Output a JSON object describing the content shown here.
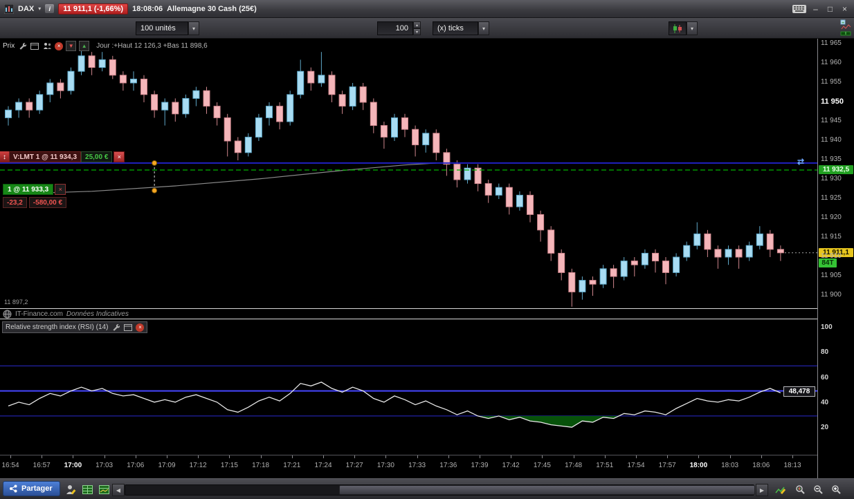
{
  "titlebar": {
    "symbol": "DAX",
    "price_badge": "11 911,1 (-1,66%)",
    "time": "18:08:06",
    "instrument": "Allemagne 30 Cash (25€)"
  },
  "toolbar": {
    "units": "100 unités",
    "interval_value": "100",
    "interval_type": "(x) ticks"
  },
  "price_pane": {
    "label": "Prix",
    "day_info": "Jour :+Haut 12 126,3 +Bas 11 898,6",
    "order_tag": {
      "text": "V:LMT 1 @ 11 934,3",
      "amount": "25,00 €"
    },
    "position_tag": {
      "text": "1 @ 11 933,3",
      "pnl_points": "-23,2",
      "pnl_amount": "-580,00 €"
    },
    "low_label": "11 897,2",
    "watermark": "IT-Finance.com",
    "watermark_note": "Données Indicatives",
    "badges": {
      "last": "11 911,1",
      "ticks": "84T",
      "position": "11 932,5"
    }
  },
  "rsi_pane": {
    "label": "Relative strength index (RSI) (14)",
    "value_label": "48,478",
    "value": 48.478
  },
  "bottombar": {
    "share": "Partager"
  },
  "icons": {
    "dropdown": "▾",
    "spin_up": "▴",
    "spin_down": "▾",
    "minimize": "–",
    "maximize": "□",
    "close": "×",
    "left": "◀",
    "right": "▶",
    "updown": "↕",
    "order_marker": "⇄",
    "sell_arrow": "▼",
    "buy_arrow": "▲",
    "info": "i",
    "x": "×"
  },
  "colors": {
    "up_fill": "#a8dcf3",
    "up_stroke": "#5fa8c9",
    "down_fill": "#f5b6ba",
    "down_stroke": "#cf868d",
    "rsi_line": "#e8e8e8",
    "level_blue": "#2b2bd0",
    "level_blue_bright": "#4646ff",
    "fill_green": "#07520a",
    "order_blue": "#2222cc",
    "position_green": "#00b300",
    "badge_yellow": "#e7c51e",
    "badge_green": "#22a022",
    "price_red_badge": "#c62828"
  },
  "x_labels": [
    {
      "t": "16:54"
    },
    {
      "t": "16:57"
    },
    {
      "t": "17:00",
      "em": true
    },
    {
      "t": "17:03"
    },
    {
      "t": "17:06"
    },
    {
      "t": "17:09"
    },
    {
      "t": "17:12"
    },
    {
      "t": "17:15"
    },
    {
      "t": "17:18"
    },
    {
      "t": "17:21"
    },
    {
      "t": "17:24"
    },
    {
      "t": "17:27"
    },
    {
      "t": "17:30"
    },
    {
      "t": "17:33"
    },
    {
      "t": "17:36"
    },
    {
      "t": "17:39"
    },
    {
      "t": "17:42"
    },
    {
      "t": "17:45"
    },
    {
      "t": "17:48"
    },
    {
      "t": "17:51"
    },
    {
      "t": "17:54"
    },
    {
      "t": "17:57"
    },
    {
      "t": "18:00",
      "em": true
    },
    {
      "t": "18:03"
    },
    {
      "t": "18:06"
    },
    {
      "t": "18:13"
    }
  ],
  "chart_data": [
    {
      "type": "candlestick",
      "title": "Prix",
      "ylim": [
        11897,
        11967
      ],
      "y_ticks": [
        {
          "v": 11965,
          "t": "11 965"
        },
        {
          "v": 11960,
          "t": "11 960"
        },
        {
          "v": 11955,
          "t": "11 955"
        },
        {
          "v": 11950,
          "t": "11 950",
          "em": true
        },
        {
          "v": 11945,
          "t": "11 945"
        },
        {
          "v": 11940,
          "t": "11 940"
        },
        {
          "v": 11935,
          "t": "11 935"
        },
        {
          "v": 11930,
          "t": "11 930"
        },
        {
          "v": 11925,
          "t": "11 925"
        },
        {
          "v": 11920,
          "t": "11 920"
        },
        {
          "v": 11915,
          "t": "11 915"
        },
        {
          "v": 11910,
          "t": "11 910"
        },
        {
          "v": 11905,
          "t": "11 905"
        },
        {
          "v": 11900,
          "t": "11 900"
        }
      ],
      "order_line": {
        "price": 11934.3
      },
      "position_line": {
        "price": 11932.5
      },
      "last_price": {
        "value": 11911.1
      },
      "day_high": 12126.3,
      "day_low": 11898.6,
      "session_low_label": 11897.2,
      "avg_line": {
        "points": [
          [
            0,
            11926.3
          ],
          [
            8,
            11927.0
          ],
          [
            16,
            11928.4
          ],
          [
            24,
            11930.2
          ],
          [
            32,
            11932.4
          ],
          [
            38,
            11933.8
          ],
          [
            41,
            11934.3
          ]
        ],
        "color": "#9a9a9a"
      },
      "handles": {
        "x_index": 14,
        "prices": [
          11934.3,
          11927.2
        ]
      },
      "candles": [
        [
          11946,
          11949,
          11944,
          11948
        ],
        [
          11948,
          11951,
          11946,
          11950
        ],
        [
          11950,
          11951,
          11946,
          11948
        ],
        [
          11948,
          11953,
          11947,
          11952
        ],
        [
          11952,
          11956,
          11950,
          11955
        ],
        [
          11955,
          11956,
          11951,
          11953
        ],
        [
          11953,
          11959,
          11952,
          11958
        ],
        [
          11958,
          11964,
          11957,
          11962
        ],
        [
          11962,
          11963,
          11957,
          11959
        ],
        [
          11959,
          11963,
          11958,
          11961
        ],
        [
          11961,
          11962,
          11956,
          11957
        ],
        [
          11957,
          11958,
          11953,
          11955
        ],
        [
          11955,
          11958,
          11953,
          11956
        ],
        [
          11956,
          11957,
          11950,
          11952
        ],
        [
          11952,
          11953,
          11946,
          11948
        ],
        [
          11948,
          11951,
          11944,
          11950
        ],
        [
          11950,
          11951,
          11945,
          11947
        ],
        [
          11947,
          11952,
          11946,
          11951
        ],
        [
          11951,
          11954,
          11949,
          11953
        ],
        [
          11953,
          11954,
          11947,
          11949
        ],
        [
          11949,
          11950,
          11944,
          11946
        ],
        [
          11946,
          11947,
          11936,
          11940
        ],
        [
          11940,
          11941,
          11935,
          11937
        ],
        [
          11937,
          11942,
          11936,
          11941
        ],
        [
          11941,
          11947,
          11940,
          11946
        ],
        [
          11946,
          11950,
          11944,
          11949
        ],
        [
          11949,
          11950,
          11943,
          11945
        ],
        [
          11945,
          11953,
          11944,
          11952
        ],
        [
          11952,
          11961,
          11951,
          11958
        ],
        [
          11958,
          11959,
          11953,
          11955
        ],
        [
          11955,
          11963,
          11954,
          11957
        ],
        [
          11957,
          11958,
          11950,
          11952
        ],
        [
          11952,
          11953,
          11947,
          11949
        ],
        [
          11949,
          11955,
          11948,
          11954
        ],
        [
          11954,
          11955,
          11948,
          11950
        ],
        [
          11950,
          11951,
          11942,
          11944
        ],
        [
          11944,
          11945,
          11938,
          11941
        ],
        [
          11941,
          11947,
          11940,
          11946
        ],
        [
          11946,
          11947,
          11941,
          11943
        ],
        [
          11943,
          11944,
          11936,
          11939
        ],
        [
          11939,
          11943,
          11937,
          11942
        ],
        [
          11942,
          11943,
          11935,
          11937
        ],
        [
          11937,
          11938,
          11931,
          11934
        ],
        [
          11934,
          11935,
          11928,
          11930
        ],
        [
          11930,
          11934,
          11929,
          11933
        ],
        [
          11933,
          11934,
          11927,
          11929
        ],
        [
          11929,
          11930,
          11924,
          11926
        ],
        [
          11926,
          11929,
          11925,
          11928
        ],
        [
          11928,
          11929,
          11921,
          11923
        ],
        [
          11923,
          11927,
          11922,
          11926
        ],
        [
          11926,
          11927,
          11919,
          11921
        ],
        [
          11921,
          11922,
          11914,
          11917
        ],
        [
          11917,
          11918,
          11909,
          11911
        ],
        [
          11911,
          11912,
          11904,
          11906
        ],
        [
          11906,
          11907,
          11897.2,
          11901
        ],
        [
          11901,
          11905,
          11899,
          11904
        ],
        [
          11904,
          11905,
          11900,
          11903
        ],
        [
          11903,
          11908,
          11902,
          11907
        ],
        [
          11907,
          11908,
          11902,
          11905
        ],
        [
          11905,
          11910,
          11904,
          11909
        ],
        [
          11909,
          11910,
          11905,
          11908
        ],
        [
          11908,
          11912,
          11907,
          11911
        ],
        [
          11911,
          11912,
          11906,
          11909
        ],
        [
          11909,
          11910,
          11903,
          11906
        ],
        [
          11906,
          11911,
          11905,
          11910
        ],
        [
          11910,
          11914,
          11909,
          11913
        ],
        [
          11913,
          11919,
          11912,
          11916
        ],
        [
          11916,
          11917,
          11910,
          11912
        ],
        [
          11912,
          11913,
          11907,
          11910
        ],
        [
          11910,
          11913,
          11908,
          11912
        ],
        [
          11912,
          11913,
          11907,
          11910
        ],
        [
          11910,
          11914,
          11909,
          11913
        ],
        [
          11913,
          11918,
          11912,
          11916
        ],
        [
          11916,
          11917,
          11910,
          11912
        ],
        [
          11912,
          11913,
          11909,
          11911.1
        ]
      ]
    },
    {
      "type": "line",
      "title": "Relative strength index (RSI) (14)",
      "ylim": [
        0,
        107
      ],
      "y_ticks": [
        {
          "v": 100,
          "t": "100"
        },
        {
          "v": 80,
          "t": "80"
        },
        {
          "v": 60,
          "t": "60"
        },
        {
          "v": 40,
          "t": "40"
        },
        {
          "v": 20,
          "t": "20"
        }
      ],
      "levels": [
        {
          "v": 70,
          "w": 1
        },
        {
          "v": 50,
          "w": 2
        },
        {
          "v": 30,
          "w": 1
        }
      ],
      "fill_below": 30,
      "last_value": 48.478,
      "values": [
        38,
        41,
        39,
        44,
        48,
        46,
        50,
        53,
        50,
        52,
        48,
        46,
        47,
        44,
        41,
        43,
        41,
        45,
        47,
        44,
        41,
        35,
        33,
        37,
        42,
        45,
        42,
        48,
        56,
        54,
        57,
        52,
        49,
        53,
        50,
        44,
        41,
        46,
        43,
        39,
        42,
        38,
        35,
        31,
        34,
        30,
        28,
        30,
        27,
        29,
        26,
        25,
        23,
        22,
        21,
        26,
        25,
        29,
        28,
        32,
        31,
        34,
        33,
        31,
        36,
        40,
        44,
        42,
        41,
        43,
        42,
        45,
        49,
        52,
        48.478
      ]
    }
  ]
}
